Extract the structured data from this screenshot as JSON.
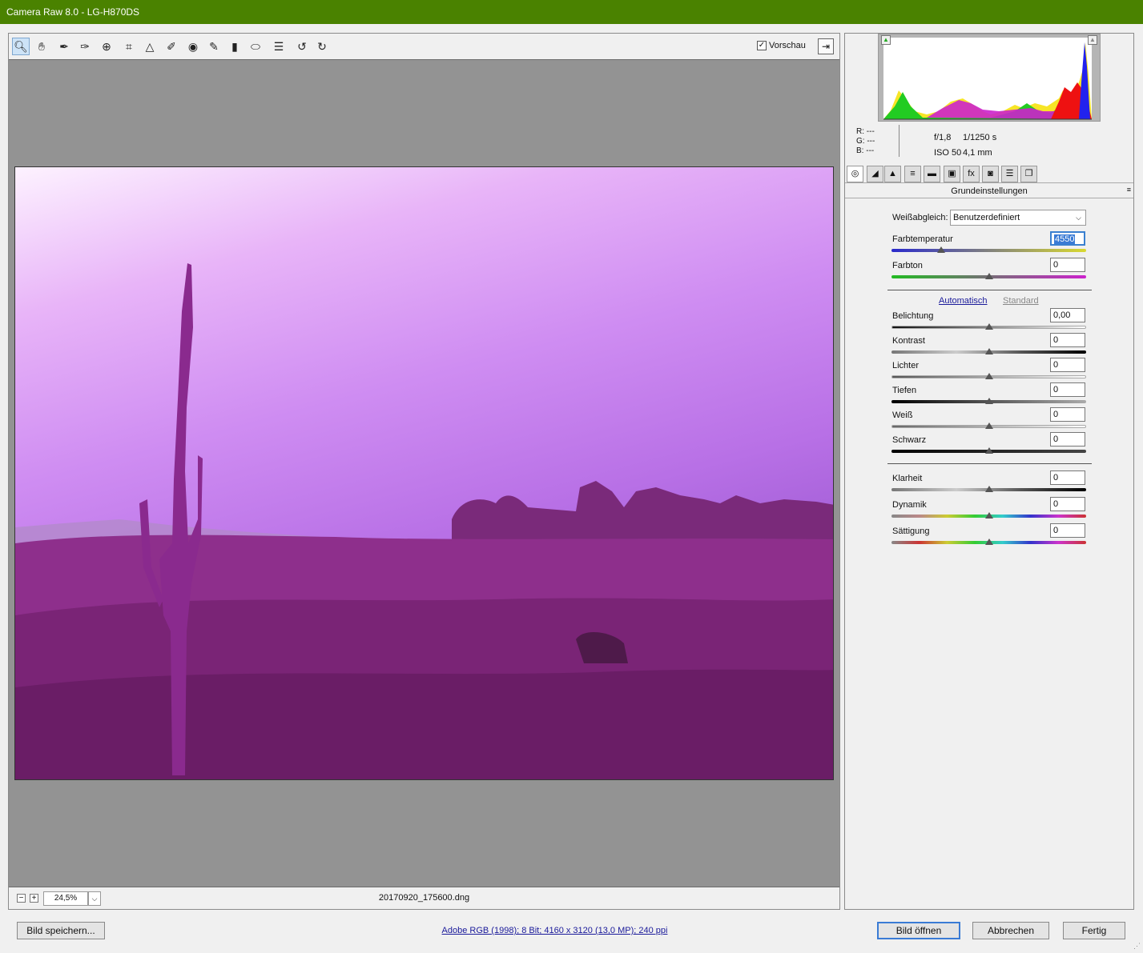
{
  "window": {
    "title": "Camera Raw 8.0 - LG-H870DS"
  },
  "toolbar": {
    "tools": [
      "zoom-icon",
      "hand-icon",
      "white-balance-eyedropper-icon",
      "color-sampler-icon",
      "targeted-adjustment-icon",
      "crop-icon",
      "straighten-icon",
      "spot-removal-icon",
      "red-eye-icon",
      "adjustment-brush-icon",
      "graduated-filter-icon",
      "radial-filter-icon",
      "preferences-icon",
      "rotate-left-icon",
      "rotate-right-icon"
    ],
    "active_tool": "zoom-icon",
    "preview_label": "Vorschau",
    "preview_checked": true
  },
  "status": {
    "zoom": "24,5%",
    "filename": "20170920_175600.dng"
  },
  "info": {
    "r_label": "R:",
    "g_label": "G:",
    "b_label": "B:",
    "r": "---",
    "g": "---",
    "b": "---",
    "aperture": "f/1,8",
    "shutter": "1/1250 s",
    "iso": "ISO 50",
    "focal": "4,1 mm"
  },
  "panel": {
    "title": "Grundeinstellungen",
    "white_balance": {
      "label": "Weißabgleich:",
      "value": "Benutzerdefiniert"
    },
    "temperature": {
      "label": "Farbtemperatur",
      "value": "4550"
    },
    "tint": {
      "label": "Farbton",
      "value": "0"
    },
    "auto_label": "Automatisch",
    "default_label": "Standard",
    "exposure": {
      "label": "Belichtung",
      "value": "0,00"
    },
    "contrast": {
      "label": "Kontrast",
      "value": "0"
    },
    "highlights": {
      "label": "Lichter",
      "value": "0"
    },
    "shadows": {
      "label": "Tiefen",
      "value": "0"
    },
    "whites": {
      "label": "Weiß",
      "value": "0"
    },
    "blacks": {
      "label": "Schwarz",
      "value": "0"
    },
    "clarity": {
      "label": "Klarheit",
      "value": "0"
    },
    "vibrance": {
      "label": "Dynamik",
      "value": "0"
    },
    "saturation": {
      "label": "Sättigung",
      "value": "0"
    }
  },
  "footer": {
    "save_label": "Bild speichern...",
    "workflow_info": "Adobe RGB (1998); 8 Bit; 4160 x 3120 (13,0 MP); 240 ppi",
    "open_label": "Bild öffnen",
    "cancel_label": "Abbrechen",
    "done_label": "Fertig"
  },
  "colors": {
    "title_bar": "#4a8200",
    "accent": "#3a7bd5",
    "photo_tint": "#b870e6"
  }
}
